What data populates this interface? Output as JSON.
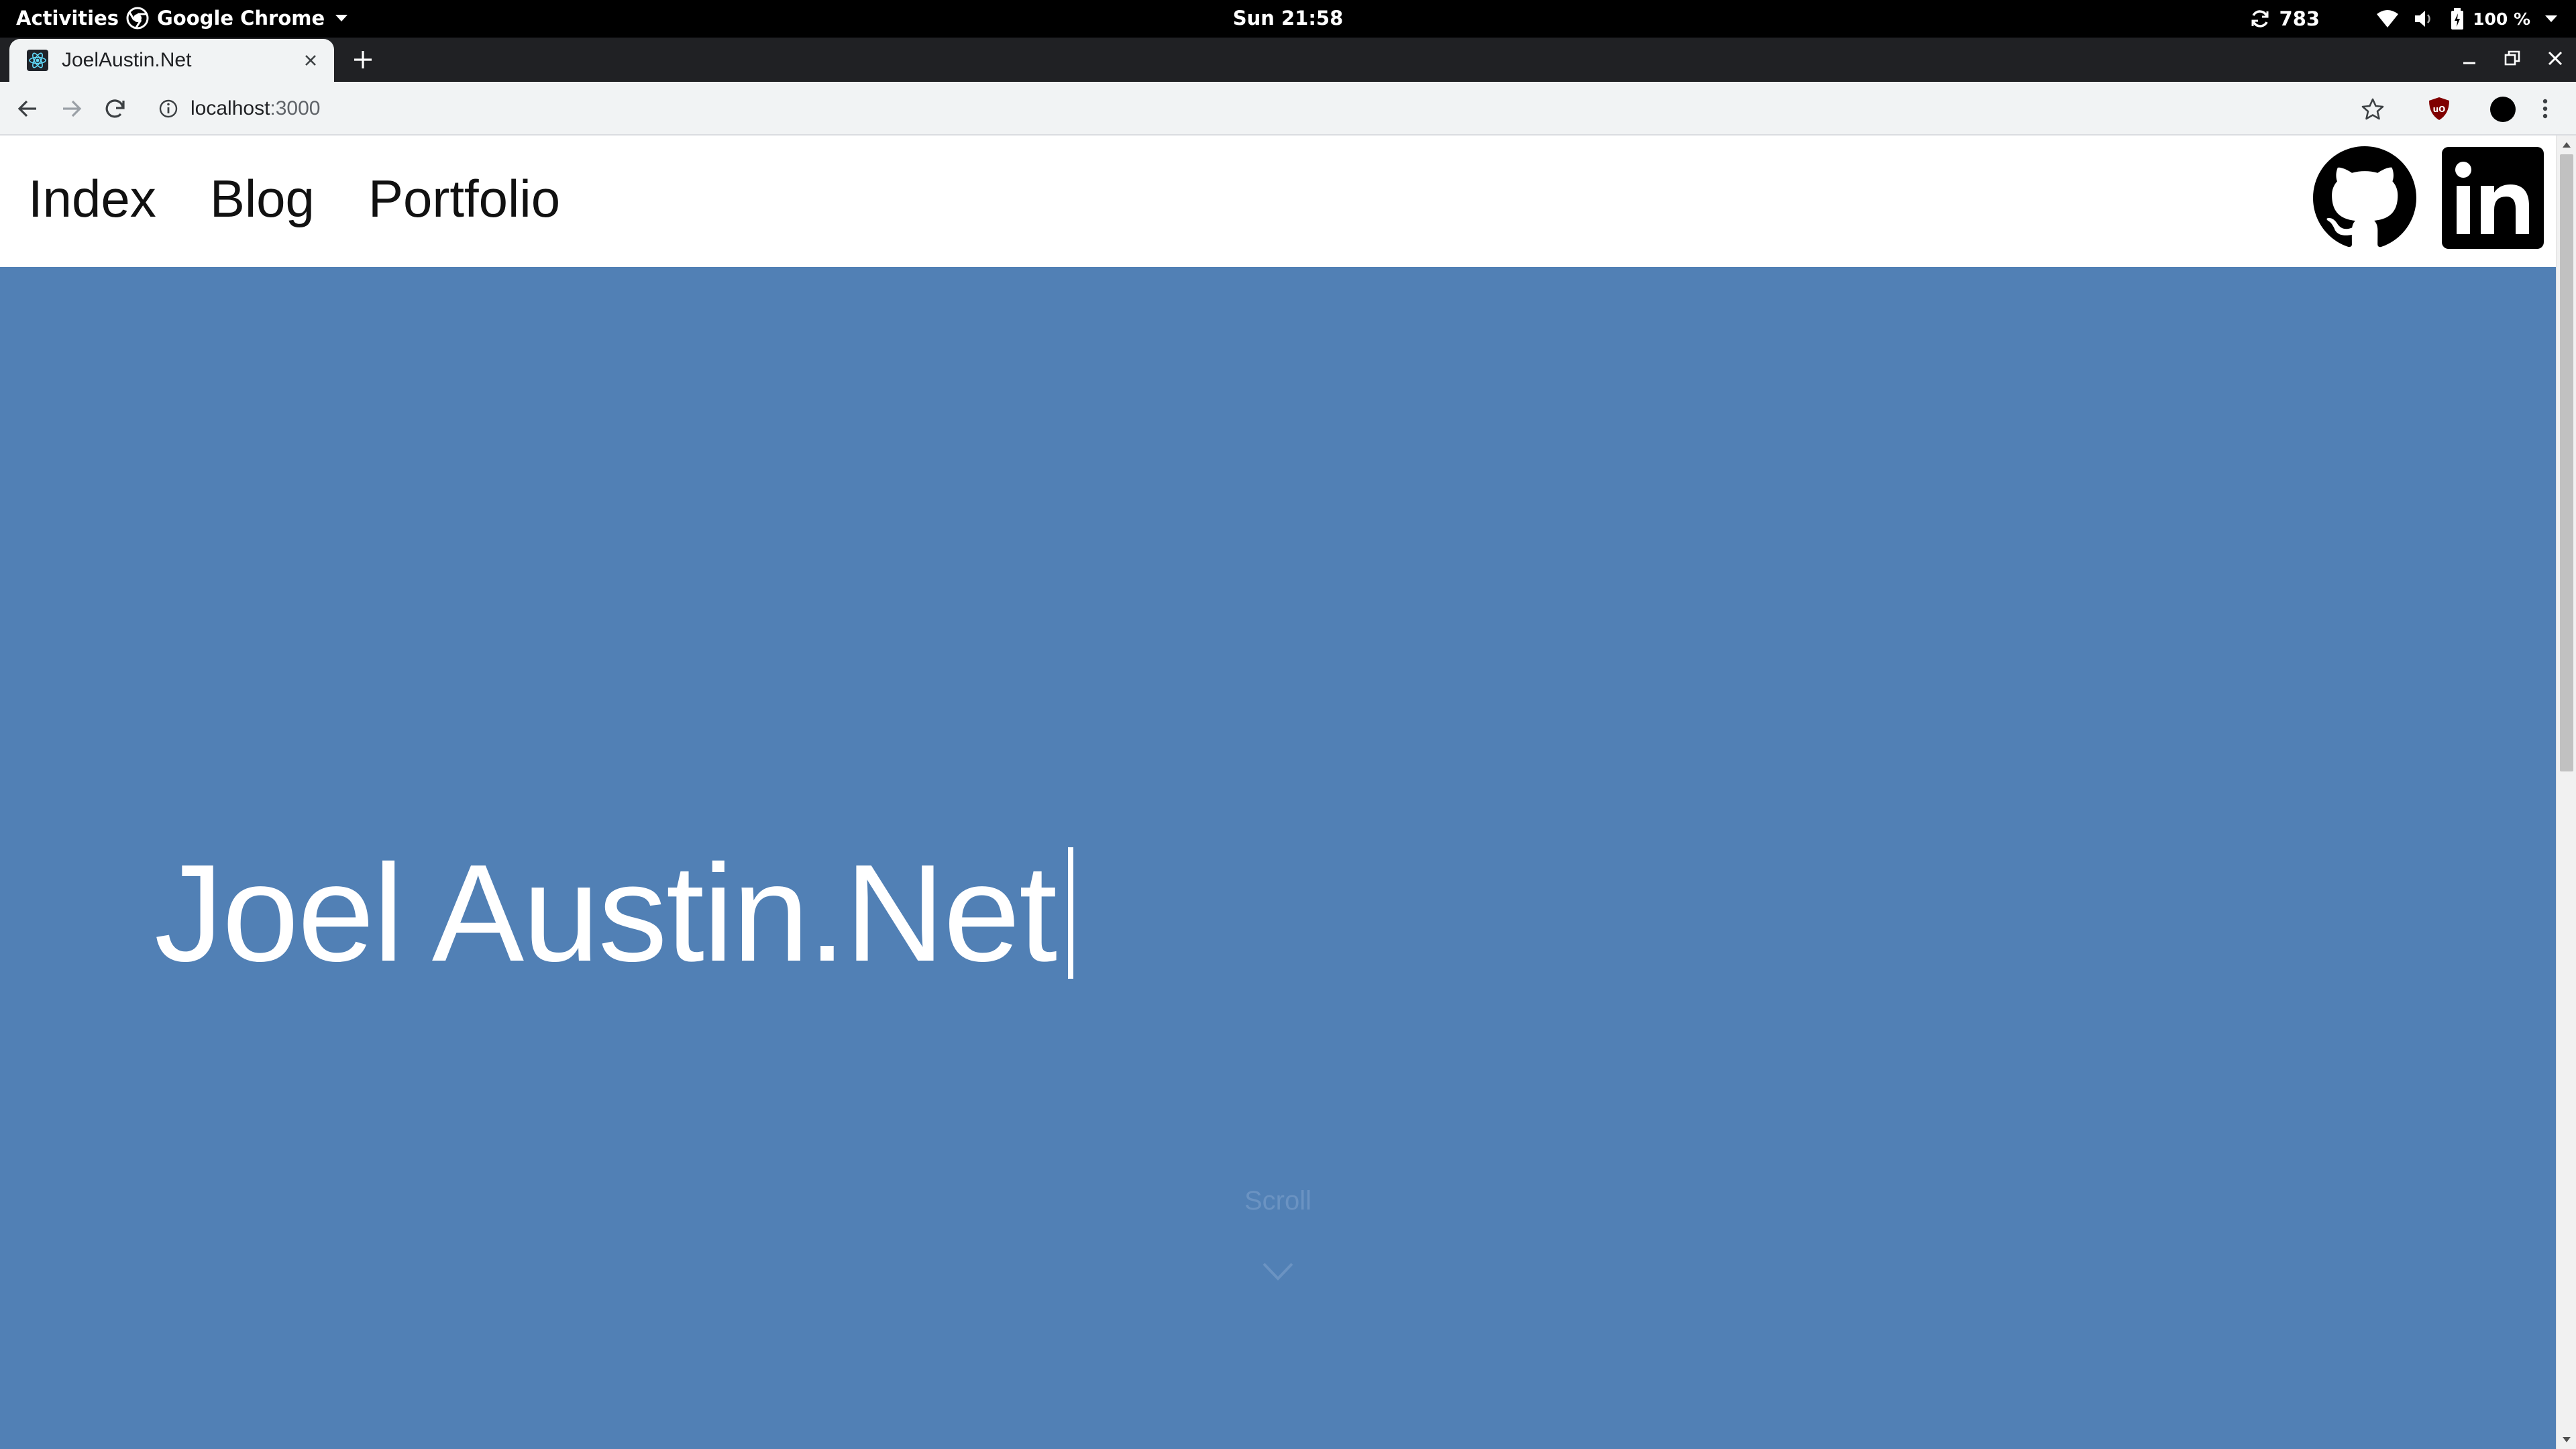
{
  "system_bar": {
    "activities": "Activities",
    "app_name": "Google Chrome",
    "clock": "Sun 21:58",
    "sync_count": "783",
    "battery": "100 %"
  },
  "browser": {
    "tab_title": "JoelAustin.Net",
    "url_host": "localhost",
    "url_port": ":3000"
  },
  "site": {
    "nav": [
      "Index",
      "Blog",
      "Portfolio"
    ],
    "hero_title": "Joel Austin.Net",
    "scroll_label": "Scroll",
    "social_icons": [
      "github-icon",
      "linkedin-icon"
    ]
  },
  "colors": {
    "hero_background": "#5180b5",
    "topbar": "#000000",
    "tabstrip": "#202124"
  }
}
